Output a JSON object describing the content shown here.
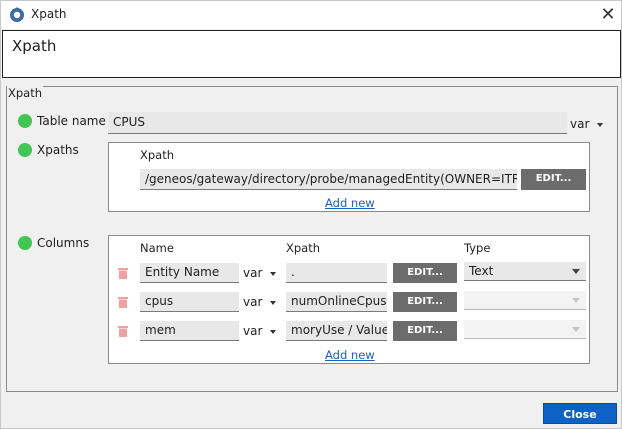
{
  "window": {
    "title": "Xpath",
    "app_icon": "gear-cog-icon",
    "close_icon": "close-icon",
    "close_glyph": "✕"
  },
  "header": {
    "title": "Xpath"
  },
  "section": {
    "legend": "Xpath"
  },
  "table_name": {
    "label": "Table name",
    "value": "CPUS",
    "var_label": "var",
    "status_color": "#42c552"
  },
  "xpaths": {
    "label": "Xpaths",
    "column_header": "Xpath",
    "rows": [
      {
        "value": "/geneos/gateway/directory/probe/managedEntity(OWNER=ITRS)",
        "edit_label": "EDIT..."
      }
    ],
    "add_new": "Add new"
  },
  "columns": {
    "label": "Columns",
    "headers": {
      "name": "Name",
      "xpath": "Xpath",
      "type": "Type"
    },
    "rows": [
      {
        "name": "Entity Name",
        "var_label": "var",
        "xpath": ".",
        "edit_label": "EDIT...",
        "type": "Text"
      },
      {
        "name": "cpus",
        "var_label": "var",
        "xpath": "numOnlineCpus",
        "edit_label": "EDIT...",
        "type": ""
      },
      {
        "name": "mem",
        "var_label": "var",
        "xpath": "moryUse / Value",
        "edit_label": "EDIT...",
        "type": ""
      }
    ],
    "add_new": "Add new"
  },
  "footer": {
    "close_label": "Close"
  },
  "colors": {
    "accent": "#0e62c6",
    "status_ok": "#42c552",
    "edit_button": "#6c6c6c",
    "delete_icon": "#f0a0a0"
  }
}
